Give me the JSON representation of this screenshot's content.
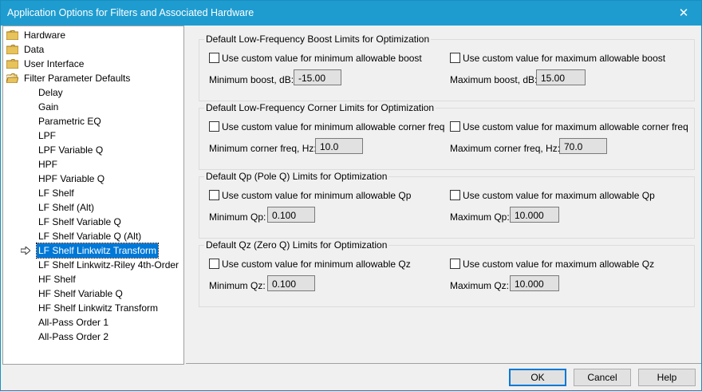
{
  "window": {
    "title": "Application Options for Filters and Associated Hardware",
    "close_glyph": "✕"
  },
  "tree": {
    "folders": [
      {
        "label": "Hardware"
      },
      {
        "label": "Data"
      },
      {
        "label": "User Interface"
      },
      {
        "label": "Filter Parameter Defaults"
      }
    ],
    "children": [
      {
        "label": "Delay"
      },
      {
        "label": "Gain"
      },
      {
        "label": "Parametric EQ"
      },
      {
        "label": "LPF"
      },
      {
        "label": "LPF Variable Q"
      },
      {
        "label": "HPF"
      },
      {
        "label": "HPF Variable Q"
      },
      {
        "label": "LF Shelf"
      },
      {
        "label": "LF Shelf (Alt)"
      },
      {
        "label": "LF Shelf Variable Q"
      },
      {
        "label": "LF Shelf Variable Q (Alt)"
      },
      {
        "label": "LF Shelf Linkwitz Transform"
      },
      {
        "label": "LF Shelf Linkwitz-Riley 4th-Order"
      },
      {
        "label": "HF Shelf"
      },
      {
        "label": "HF Shelf Variable Q"
      },
      {
        "label": "HF Shelf Linkwitz Transform"
      },
      {
        "label": "All-Pass Order 1"
      },
      {
        "label": "All-Pass Order 2"
      }
    ],
    "selected": "LF Shelf Linkwitz Transform"
  },
  "groups": [
    {
      "title": "Default Low-Frequency Boost Limits for Optimization",
      "min_check": "Use custom value for minimum allowable boost",
      "max_check": "Use custom value for maximum allowable boost",
      "min_label": "Minimum boost, dB:",
      "min_value": "-15.00",
      "max_label": "Maximum boost, dB:",
      "max_value": "15.00"
    },
    {
      "title": "Default Low-Frequency Corner Limits for Optimization",
      "min_check": "Use custom value for minimum allowable corner freq",
      "max_check": "Use custom value for maximum allowable corner freq",
      "min_label": "Minimum corner freq, Hz:",
      "min_value": "10.0",
      "max_label": "Maximum corner freq, Hz:",
      "max_value": "70.0"
    },
    {
      "title": "Default Qp (Pole Q) Limits for Optimization",
      "min_check": "Use custom value for minimum allowable Qp",
      "max_check": "Use custom value for maximum allowable Qp",
      "min_label": "Minimum Qp:",
      "min_value": "0.100",
      "max_label": "Maximum Qp:",
      "max_value": "10.000"
    },
    {
      "title": "Default Qz (Zero Q) Limits for Optimization",
      "min_check": "Use custom value for minimum allowable Qz",
      "max_check": "Use custom value for maximum allowable Qz",
      "min_label": "Minimum Qz:",
      "min_value": "0.100",
      "max_label": "Maximum Qz:",
      "max_value": "10.000"
    }
  ],
  "buttons": {
    "ok": "OK",
    "cancel": "Cancel",
    "help": "Help"
  },
  "colors": {
    "titlebar": "#1e9cd0",
    "selection": "#0078d7",
    "folder": "#e8c25a"
  }
}
